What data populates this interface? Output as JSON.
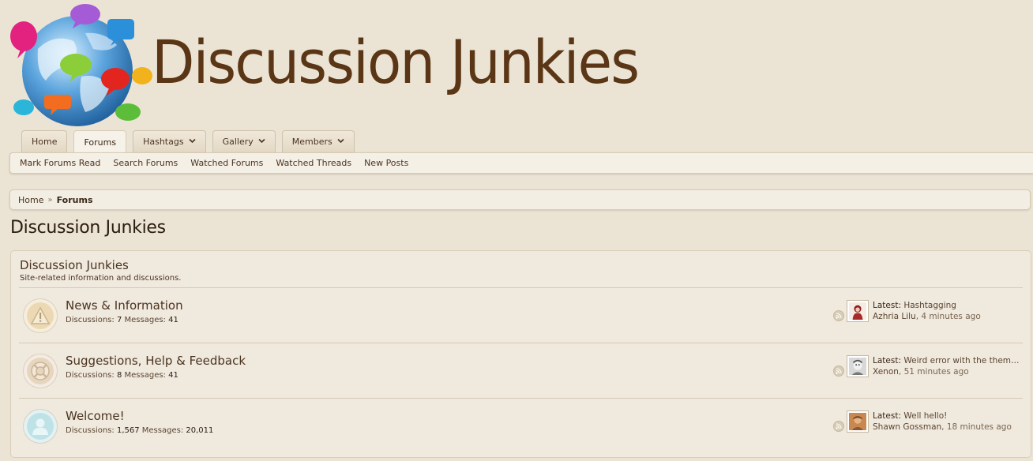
{
  "site": {
    "name": "Discussion Junkies",
    "colors": {
      "background": "#ebe3d4",
      "text": "#3f2c1c",
      "logo_text": "#5a3616"
    }
  },
  "tabs": [
    {
      "label": "Home",
      "has_dropdown": false,
      "active": false
    },
    {
      "label": "Forums",
      "has_dropdown": false,
      "active": true
    },
    {
      "label": "Hashtags",
      "has_dropdown": true,
      "active": false
    },
    {
      "label": "Gallery",
      "has_dropdown": true,
      "active": false
    },
    {
      "label": "Members",
      "has_dropdown": true,
      "active": false
    }
  ],
  "subnav": [
    {
      "label": "Mark Forums Read"
    },
    {
      "label": "Search Forums"
    },
    {
      "label": "Watched Forums"
    },
    {
      "label": "Watched Threads"
    },
    {
      "label": "New Posts"
    }
  ],
  "breadcrumb": [
    {
      "label": "Home",
      "current": false
    },
    {
      "label": "Forums",
      "current": true
    }
  ],
  "page_title": "Discussion Junkies",
  "category": {
    "title": "Discussion Junkies",
    "description": "Site-related information and discussions.",
    "forums": [
      {
        "title": "News & Information",
        "icon": "warning-icon",
        "stats": {
          "discussions_label": "Discussions:",
          "discussions": "7",
          "messages_label": "Messages:",
          "messages": "41"
        },
        "latest": {
          "label": "Latest:",
          "title": "Hashtagging",
          "user": "Azhria Lilu",
          "time": ", 4 minutes ago"
        }
      },
      {
        "title": "Suggestions, Help & Feedback",
        "icon": "lifebuoy-icon",
        "stats": {
          "discussions_label": "Discussions:",
          "discussions": "8",
          "messages_label": "Messages:",
          "messages": "41"
        },
        "latest": {
          "label": "Latest:",
          "title": "Weird error with the them…",
          "user": "Xenon",
          "time": ", 51 minutes ago"
        }
      },
      {
        "title": "Welcome!",
        "icon": "user-icon",
        "stats": {
          "discussions_label": "Discussions:",
          "discussions": "1,567",
          "messages_label": "Messages:",
          "messages": "20,011"
        },
        "latest": {
          "label": "Latest:",
          "title": "Well hello!",
          "user": "Shawn Gossman",
          "time": ", 18 minutes ago"
        }
      }
    ]
  },
  "separator": "»"
}
